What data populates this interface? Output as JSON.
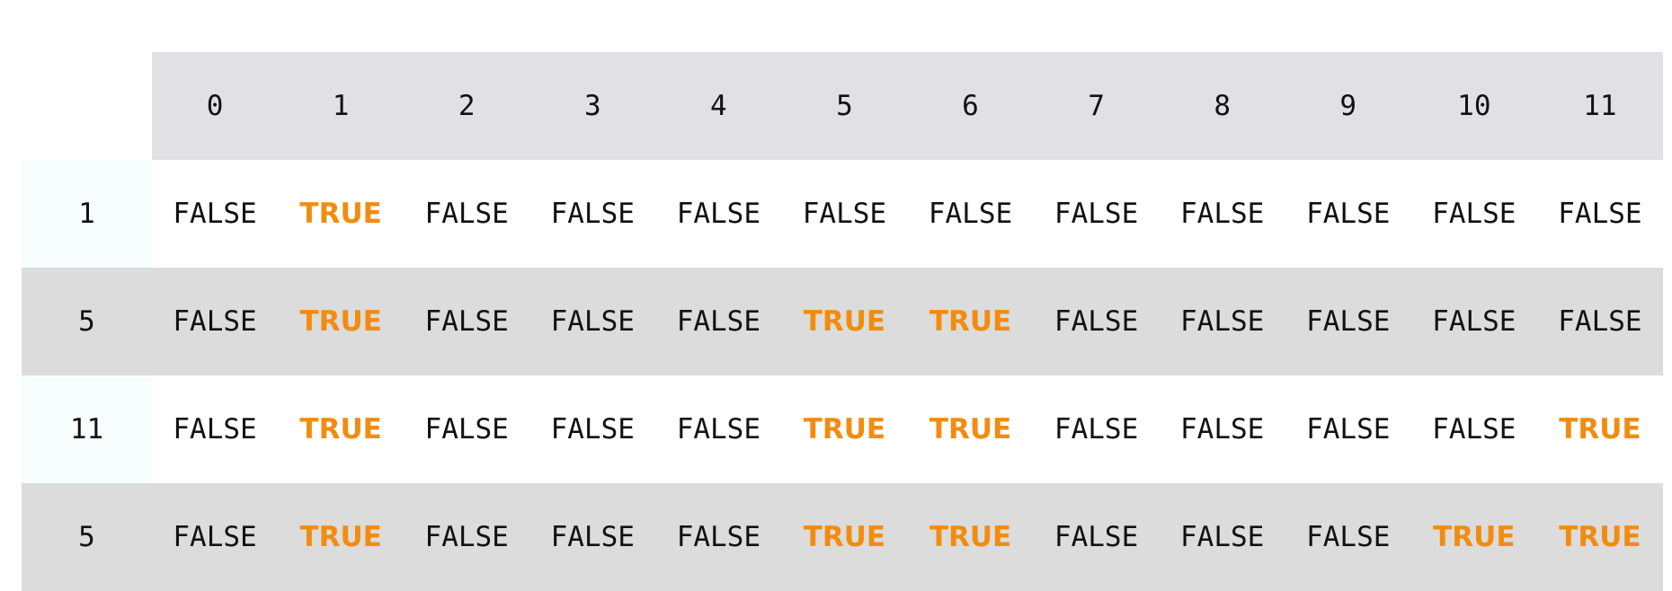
{
  "table": {
    "columns": [
      "0",
      "1",
      "2",
      "3",
      "4",
      "5",
      "6",
      "7",
      "8",
      "9",
      "10",
      "11"
    ],
    "rows": [
      {
        "label": "1",
        "cells": [
          "FALSE",
          "TRUE",
          "FALSE",
          "FALSE",
          "FALSE",
          "FALSE",
          "FALSE",
          "FALSE",
          "FALSE",
          "FALSE",
          "FALSE",
          "FALSE"
        ]
      },
      {
        "label": "5",
        "cells": [
          "FALSE",
          "TRUE",
          "FALSE",
          "FALSE",
          "FALSE",
          "TRUE",
          "TRUE",
          "FALSE",
          "FALSE",
          "FALSE",
          "FALSE",
          "FALSE"
        ]
      },
      {
        "label": "11",
        "cells": [
          "FALSE",
          "TRUE",
          "FALSE",
          "FALSE",
          "FALSE",
          "TRUE",
          "TRUE",
          "FALSE",
          "FALSE",
          "FALSE",
          "FALSE",
          "TRUE"
        ]
      },
      {
        "label": "5",
        "cells": [
          "FALSE",
          "TRUE",
          "FALSE",
          "FALSE",
          "FALSE",
          "TRUE",
          "TRUE",
          "FALSE",
          "FALSE",
          "FALSE",
          "TRUE",
          "TRUE"
        ]
      }
    ]
  },
  "colors": {
    "true_text": "#f28c0f",
    "false_text": "#111111",
    "header_background": "#e0e0e5",
    "striped_row_background": "#dcdcdc",
    "row_header_background": "#f7fdfd"
  }
}
